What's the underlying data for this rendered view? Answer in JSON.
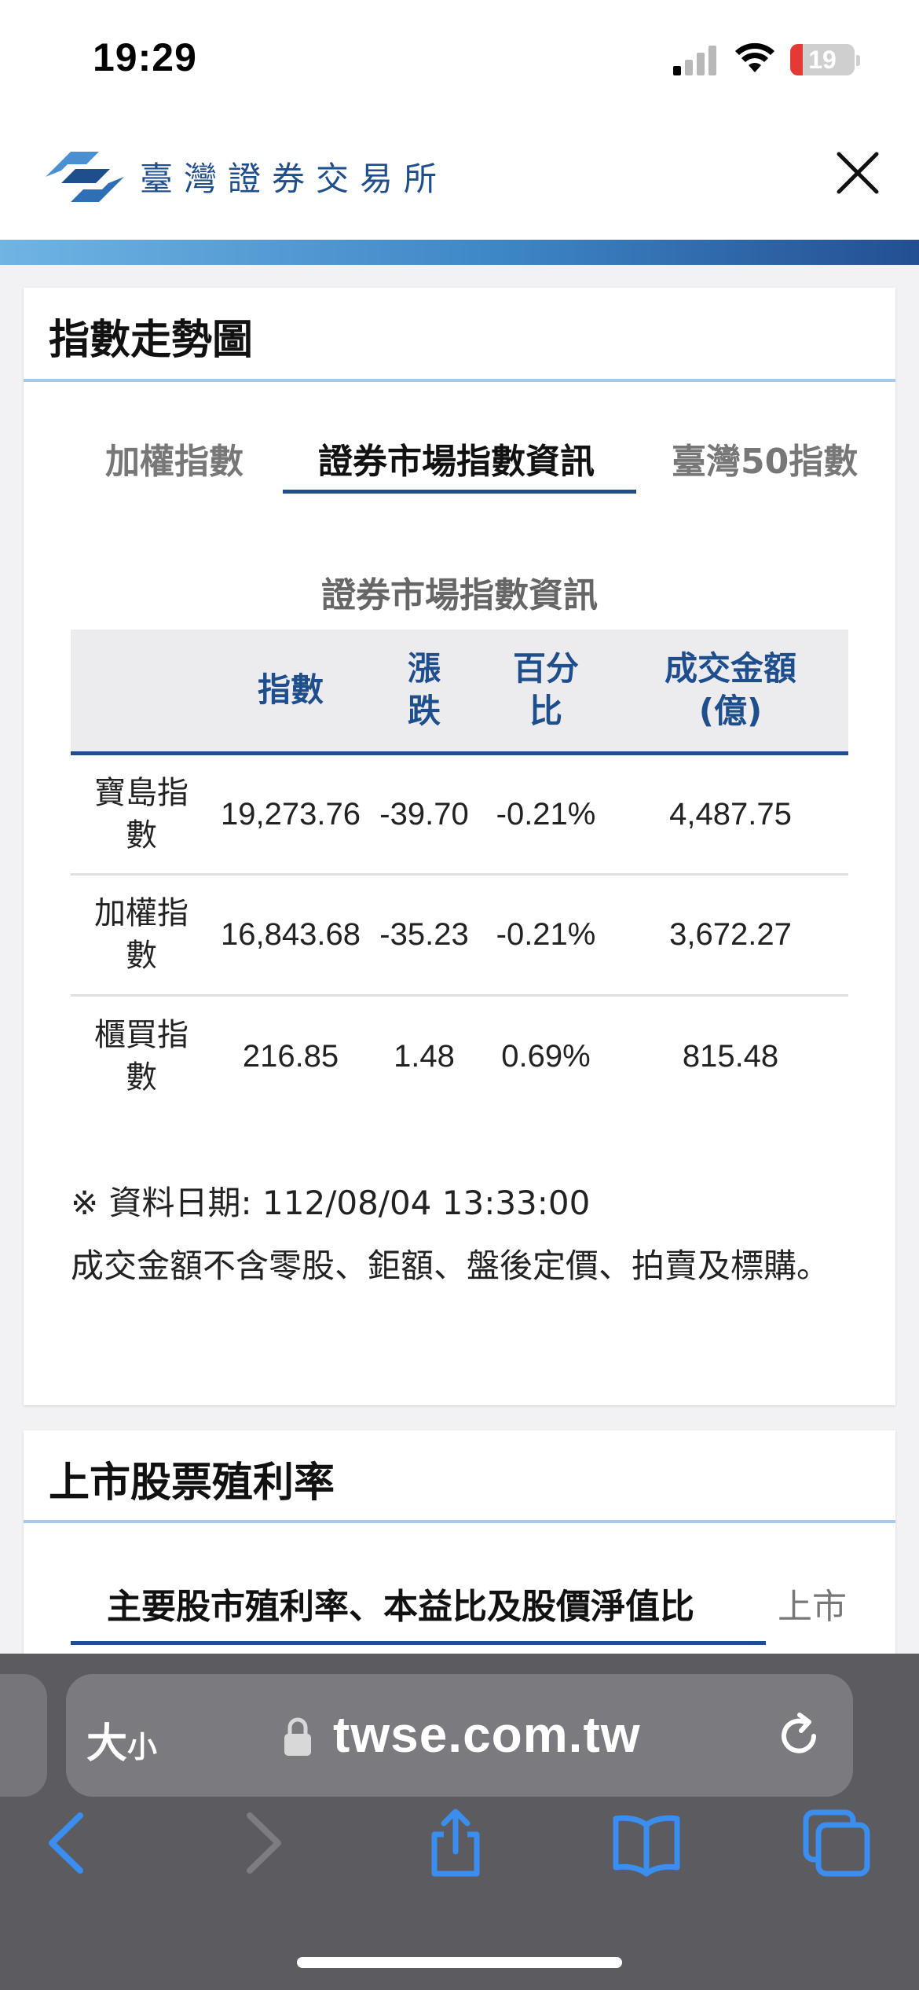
{
  "status_bar": {
    "time": "19:29",
    "battery": "19"
  },
  "header": {
    "site_name": "臺灣證券交易所"
  },
  "index_card": {
    "title": "指數走勢圖",
    "tabs": [
      {
        "label": "加權指數",
        "active": false
      },
      {
        "label": "證券市場指數資訊",
        "active": true
      },
      {
        "label": "臺灣50指數",
        "active": false
      }
    ],
    "section_caption": "證券市場指數資訊",
    "columns": [
      "",
      "指數",
      "漲跌",
      "百分比",
      "成交金額(億)"
    ],
    "column_display": [
      "",
      "指數",
      "漲\n跌",
      "百分\n比",
      "成交金額\n(億)"
    ],
    "rows": [
      {
        "name": "寶島指數",
        "name_display": "寶島指\n數",
        "index": "19,273.76",
        "change": "-39.70",
        "percent": "-0.21%",
        "amount": "4,487.75"
      },
      {
        "name": "加權指數",
        "name_display": "加權指\n數",
        "index": "16,843.68",
        "change": "-35.23",
        "percent": "-0.21%",
        "amount": "3,672.27"
      },
      {
        "name": "櫃買指數",
        "name_display": "櫃買指\n數",
        "index": "216.85",
        "change": "1.48",
        "percent": "0.69%",
        "amount": "815.48"
      }
    ],
    "data_date": "※ 資料日期: 112/08/04 13:33:00",
    "note": "成交金額不含零股、鉅額、盤後定價、拍賣及標購。"
  },
  "yield_card": {
    "title": "上市股票殖利率",
    "tabs": [
      {
        "label": "主要股市殖利率、本益比及股價淨值比",
        "active": true
      },
      {
        "label": "上市",
        "active": false
      }
    ]
  },
  "browser": {
    "text_size_label": "大",
    "text_size_small": "小",
    "url": "twse.com.tw"
  },
  "colors": {
    "brand_blue": "#1f4e8c",
    "accent_light": "#a9c8ec",
    "toolbar_icon": "#3a8ef0",
    "battery_low": "#e53935"
  }
}
